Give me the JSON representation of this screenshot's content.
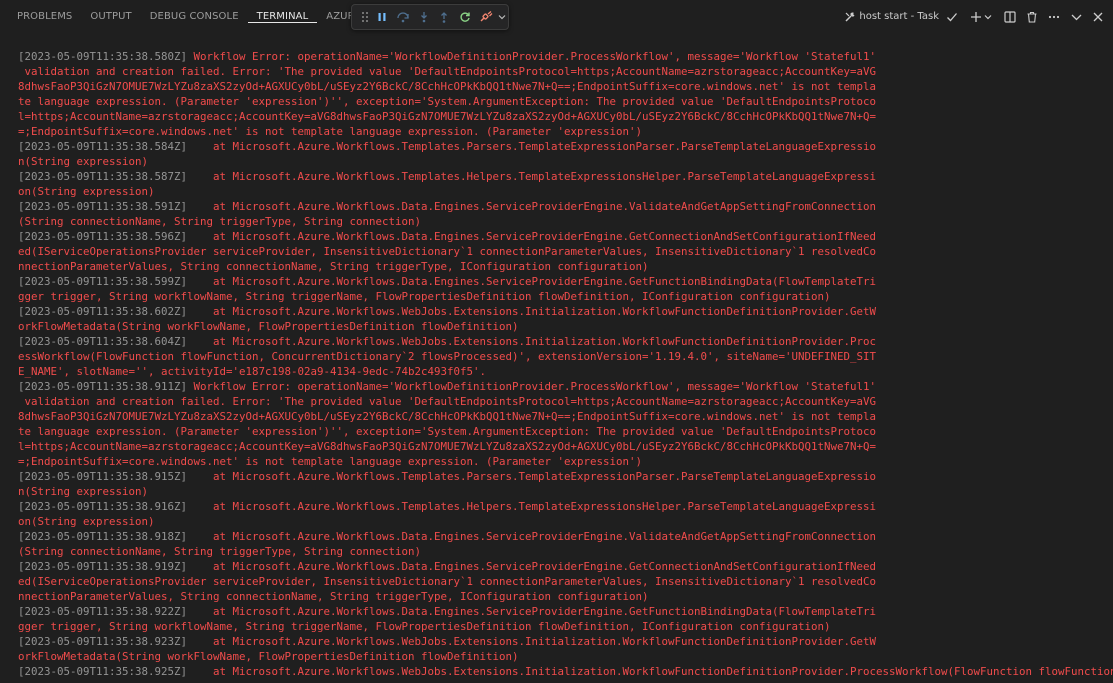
{
  "panel": {
    "tabs": [
      "PROBLEMS",
      "OUTPUT",
      "DEBUG CONSOLE",
      "TERMINAL",
      "AZURE"
    ],
    "active_tab": "TERMINAL"
  },
  "debug_toolbar": {
    "buttons": [
      "drag-grip",
      "pause",
      "step-over",
      "step-into",
      "step-out",
      "restart",
      "disconnect",
      "more-options"
    ]
  },
  "actions": {
    "task_label": "host start - Task",
    "buttons": [
      "task-check",
      "new-terminal",
      "launch-profile-dropdown",
      "split-terminal",
      "kill-terminal",
      "more-actions",
      "collapse-panel",
      "close-panel"
    ]
  },
  "colors": {
    "background": "#1f1f1f",
    "error_text": "#f14c4c",
    "timestamp_text": "#949494",
    "active_tab": "#e7e7e7",
    "inactive_tab": "#9d9d9d"
  },
  "terminal": {
    "lines": [
      {
        "ts": "[2023-05-09T11:35:38.580Z]",
        "msg": " Workflow Error: operationName='WorkflowDefinitionProvider.ProcessWorkflow', message='Workflow 'Stateful1'"
      },
      {
        "ts": "",
        "msg": " validation and creation failed. Error: 'The provided value 'DefaultEndpointsProtocol=https;AccountName=azrstorageacc;AccountKey=aVG"
      },
      {
        "ts": "",
        "msg": "8dhwsFaoP3QiGzN7OMUE7WzLYZu8zaXS2zyOd+AGXUCy0bL/uSEyz2Y6BckC/8CchHcOPkKbQQ1tNwe7N+Q==;EndpointSuffix=core.windows.net' is not templa"
      },
      {
        "ts": "",
        "msg": "te language expression. (Parameter 'expression')'', exception='System.ArgumentException: The provided value 'DefaultEndpointsProtoco"
      },
      {
        "ts": "",
        "msg": "l=https;AccountName=azrstorageacc;AccountKey=aVG8dhwsFaoP3QiGzN7OMUE7WzLYZu8zaXS2zyOd+AGXUCy0bL/uSEyz2Y6BckC/8CchHcOPkKbQQ1tNwe7N+Q="
      },
      {
        "ts": "",
        "msg": "=;EndpointSuffix=core.windows.net' is not template language expression. (Parameter 'expression')"
      },
      {
        "ts": "[2023-05-09T11:35:38.584Z]",
        "msg": "    at Microsoft.Azure.Workflows.Templates.Parsers.TemplateExpressionParser.ParseTemplateLanguageExpressio"
      },
      {
        "ts": "",
        "msg": "n(String expression)"
      },
      {
        "ts": "[2023-05-09T11:35:38.587Z]",
        "msg": "    at Microsoft.Azure.Workflows.Templates.Helpers.TemplateExpressionsHelper.ParseTemplateLanguageExpressi"
      },
      {
        "ts": "",
        "msg": "on(String expression)"
      },
      {
        "ts": "[2023-05-09T11:35:38.591Z]",
        "msg": "    at Microsoft.Azure.Workflows.Data.Engines.ServiceProviderEngine.ValidateAndGetAppSettingFromConnection"
      },
      {
        "ts": "",
        "msg": "(String connectionName, String triggerType, String connection)"
      },
      {
        "ts": "[2023-05-09T11:35:38.596Z]",
        "msg": "    at Microsoft.Azure.Workflows.Data.Engines.ServiceProviderEngine.GetConnectionAndSetConfigurationIfNeed"
      },
      {
        "ts": "",
        "msg": "ed(IServiceOperationsProvider serviceProvider, InsensitiveDictionary`1 connectionParameterValues, InsensitiveDictionary`1 resolvedCo"
      },
      {
        "ts": "",
        "msg": "nnectionParameterValues, String connectionName, String triggerType, IConfiguration configuration)"
      },
      {
        "ts": "[2023-05-09T11:35:38.599Z]",
        "msg": "    at Microsoft.Azure.Workflows.Data.Engines.ServiceProviderEngine.GetFunctionBindingData(FlowTemplateTri"
      },
      {
        "ts": "",
        "msg": "gger trigger, String workflowName, String triggerName, FlowPropertiesDefinition flowDefinition, IConfiguration configuration)"
      },
      {
        "ts": "[2023-05-09T11:35:38.602Z]",
        "msg": "    at Microsoft.Azure.Workflows.WebJobs.Extensions.Initialization.WorkflowFunctionDefinitionProvider.GetW"
      },
      {
        "ts": "",
        "msg": "orkFlowMetadata(String workFlowName, FlowPropertiesDefinition flowDefinition)"
      },
      {
        "ts": "[2023-05-09T11:35:38.604Z]",
        "msg": "    at Microsoft.Azure.Workflows.WebJobs.Extensions.Initialization.WorkflowFunctionDefinitionProvider.Proc"
      },
      {
        "ts": "",
        "msg": "essWorkflow(FlowFunction flowFunction, ConcurrentDictionary`2 flowsProcessed)', extensionVersion='1.19.4.0', siteName='UNDEFINED_SIT"
      },
      {
        "ts": "",
        "msg": "E_NAME', slotName='', activityId='e187c198-02a9-4134-9edc-74b2c493f0f5'."
      },
      {
        "ts": "[2023-05-09T11:35:38.911Z]",
        "msg": " Workflow Error: operationName='WorkflowDefinitionProvider.ProcessWorkflow', message='Workflow 'Stateful1'"
      },
      {
        "ts": "",
        "msg": " validation and creation failed. Error: 'The provided value 'DefaultEndpointsProtocol=https;AccountName=azrstorageacc;AccountKey=aVG"
      },
      {
        "ts": "",
        "msg": "8dhwsFaoP3QiGzN7OMUE7WzLYZu8zaXS2zyOd+AGXUCy0bL/uSEyz2Y6BckC/8CchHcOPkKbQQ1tNwe7N+Q==;EndpointSuffix=core.windows.net' is not templa"
      },
      {
        "ts": "",
        "msg": "te language expression. (Parameter 'expression')'', exception='System.ArgumentException: The provided value 'DefaultEndpointsProtoco"
      },
      {
        "ts": "",
        "msg": "l=https;AccountName=azrstorageacc;AccountKey=aVG8dhwsFaoP3QiGzN7OMUE7WzLYZu8zaXS2zyOd+AGXUCy0bL/uSEyz2Y6BckC/8CchHcOPkKbQQ1tNwe7N+Q="
      },
      {
        "ts": "",
        "msg": "=;EndpointSuffix=core.windows.net' is not template language expression. (Parameter 'expression')"
      },
      {
        "ts": "[2023-05-09T11:35:38.915Z]",
        "msg": "    at Microsoft.Azure.Workflows.Templates.Parsers.TemplateExpressionParser.ParseTemplateLanguageExpressio"
      },
      {
        "ts": "",
        "msg": "n(String expression)"
      },
      {
        "ts": "[2023-05-09T11:35:38.916Z]",
        "msg": "    at Microsoft.Azure.Workflows.Templates.Helpers.TemplateExpressionsHelper.ParseTemplateLanguageExpressi"
      },
      {
        "ts": "",
        "msg": "on(String expression)"
      },
      {
        "ts": "[2023-05-09T11:35:38.918Z]",
        "msg": "    at Microsoft.Azure.Workflows.Data.Engines.ServiceProviderEngine.ValidateAndGetAppSettingFromConnection"
      },
      {
        "ts": "",
        "msg": "(String connectionName, String triggerType, String connection)"
      },
      {
        "ts": "[2023-05-09T11:35:38.919Z]",
        "msg": "    at Microsoft.Azure.Workflows.Data.Engines.ServiceProviderEngine.GetConnectionAndSetConfigurationIfNeed"
      },
      {
        "ts": "",
        "msg": "ed(IServiceOperationsProvider serviceProvider, InsensitiveDictionary`1 connectionParameterValues, InsensitiveDictionary`1 resolvedCo"
      },
      {
        "ts": "",
        "msg": "nnectionParameterValues, String connectionName, String triggerType, IConfiguration configuration)"
      },
      {
        "ts": "[2023-05-09T11:35:38.922Z]",
        "msg": "    at Microsoft.Azure.Workflows.Data.Engines.ServiceProviderEngine.GetFunctionBindingData(FlowTemplateTri"
      },
      {
        "ts": "",
        "msg": "gger trigger, String workflowName, String triggerName, FlowPropertiesDefinition flowDefinition, IConfiguration configuration)"
      },
      {
        "ts": "[2023-05-09T11:35:38.923Z]",
        "msg": "    at Microsoft.Azure.Workflows.WebJobs.Extensions.Initialization.WorkflowFunctionDefinitionProvider.GetW"
      },
      {
        "ts": "",
        "msg": "orkFlowMetadata(String workFlowName, FlowPropertiesDefinition flowDefinition)"
      },
      {
        "ts": "[2023-05-09T11:35:38.925Z]",
        "msg": "    at Microsoft.Azure.Workflows.WebJobs.Extensions.Initialization.WorkflowFunctionDefinitionProvider.ProcessWorkflow(FlowFunction flowFunction, ConcurrentDi"
      }
    ]
  }
}
